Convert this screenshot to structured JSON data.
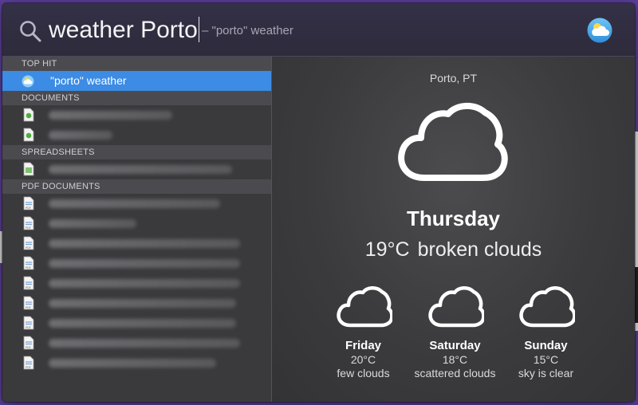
{
  "search": {
    "query": "weather Porto",
    "hint": "– \"porto\" weather"
  },
  "results": {
    "top_hit": {
      "header": "TOP HIT",
      "item": "\"porto\" weather"
    },
    "documents": {
      "header": "DOCUMENTS",
      "count": 2
    },
    "spreadsheets": {
      "header": "SPREADSHEETS",
      "count": 1
    },
    "pdf_documents": {
      "header": "PDF DOCUMENTS",
      "count": 9
    }
  },
  "weather": {
    "location": "Porto, PT",
    "day": "Thursday",
    "temperature": "19°C",
    "condition": "broken clouds",
    "forecast": [
      {
        "day": "Friday",
        "temp": "20°C",
        "desc": "few clouds"
      },
      {
        "day": "Saturday",
        "temp": "18°C",
        "desc": "scattered clouds"
      },
      {
        "day": "Sunday",
        "temp": "15°C",
        "desc": "sky is clear"
      }
    ]
  },
  "colors": {
    "selection": "#3c8be4",
    "background": "#5b3f98"
  }
}
